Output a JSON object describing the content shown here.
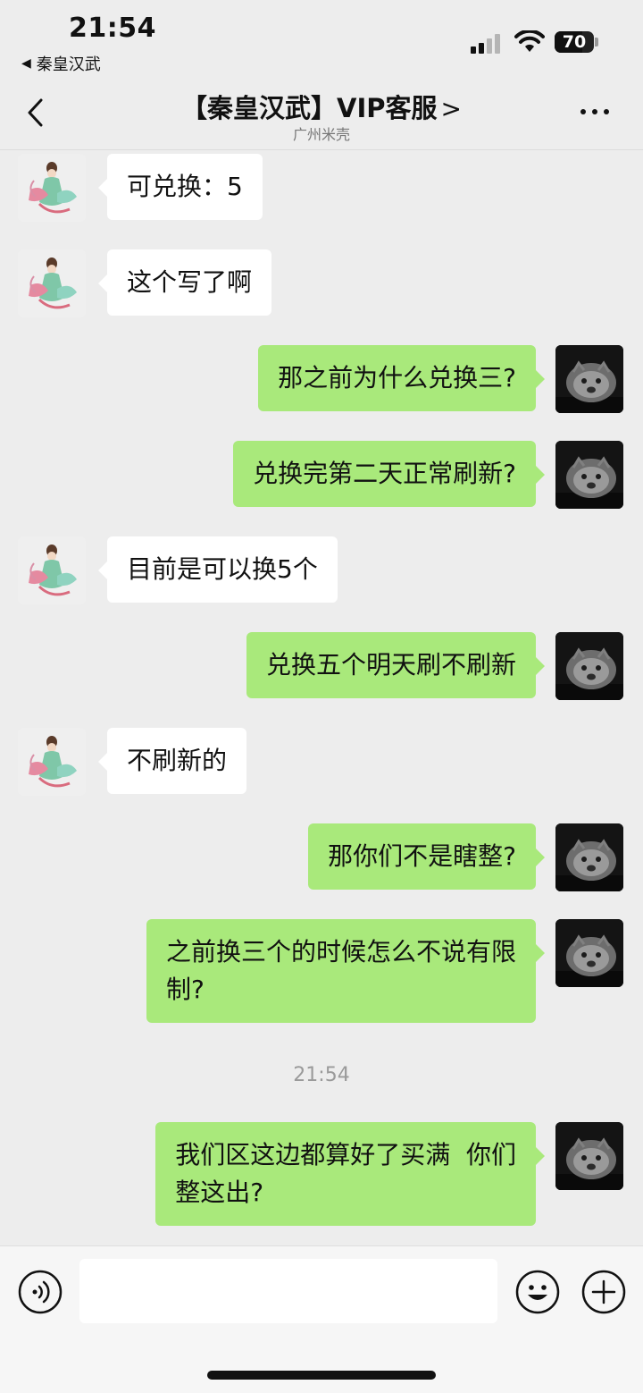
{
  "status_bar": {
    "time": "21:54",
    "back_app": "秦皇汉武",
    "battery_level": 70,
    "battery_text": "70"
  },
  "nav": {
    "title": "【秦皇汉武】VIP客服",
    "title_chevron": ">",
    "subtitle": "广州米壳"
  },
  "colors": {
    "background": "#ededed",
    "my_bubble": "#a9e97b",
    "their_bubble": "#ffffff"
  },
  "messages": [
    {
      "side": "them",
      "text": "可兑换：5"
    },
    {
      "side": "them",
      "text": "这个写了啊"
    },
    {
      "side": "me",
      "text": "那之前为什么兑换三?"
    },
    {
      "side": "me",
      "text": "兑换完第二天正常刷新?"
    },
    {
      "side": "them",
      "text": "目前是可以换5个"
    },
    {
      "side": "me",
      "text": "兑换五个明天刷不刷新"
    },
    {
      "side": "them",
      "text": "不刷新的"
    },
    {
      "side": "me",
      "text": "那你们不是瞎整?"
    },
    {
      "side": "me",
      "text": "之前换三个的时候怎么不说有限\n制?"
    },
    {
      "side": "me",
      "text": "我们区这边都算好了买满  你们\n整这出?"
    }
  ],
  "timestamp": "21:54",
  "input_bar": {
    "input_value": "",
    "voice_icon": "voice-icon",
    "emoji_icon": "emoji-icon",
    "plus_icon": "plus-icon"
  }
}
